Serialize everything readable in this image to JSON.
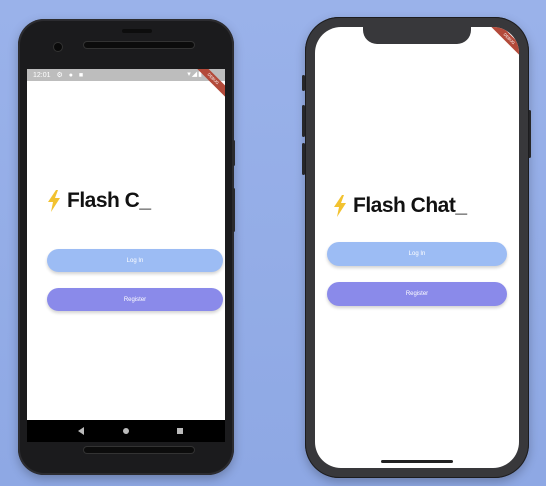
{
  "colors": {
    "background": "#9ab2ea",
    "login_button": "#9cbcf4",
    "register_button": "#8a8aea",
    "bolt": "#f2c230",
    "debug_banner": "#b34a3a"
  },
  "android": {
    "status_time": "12:01",
    "debug_label": "DEBUG",
    "title": "Flash C_",
    "login_label": "Log In",
    "register_label": "Register"
  },
  "iphone": {
    "debug_label": "DEBUG",
    "title": "Flash Chat_",
    "login_label": "Log In",
    "register_label": "Register"
  },
  "icons": {
    "logo": "lightning-bolt-icon",
    "nav_back": "triangle-back-icon",
    "nav_home": "circle-home-icon",
    "nav_recent": "square-recent-icon"
  }
}
